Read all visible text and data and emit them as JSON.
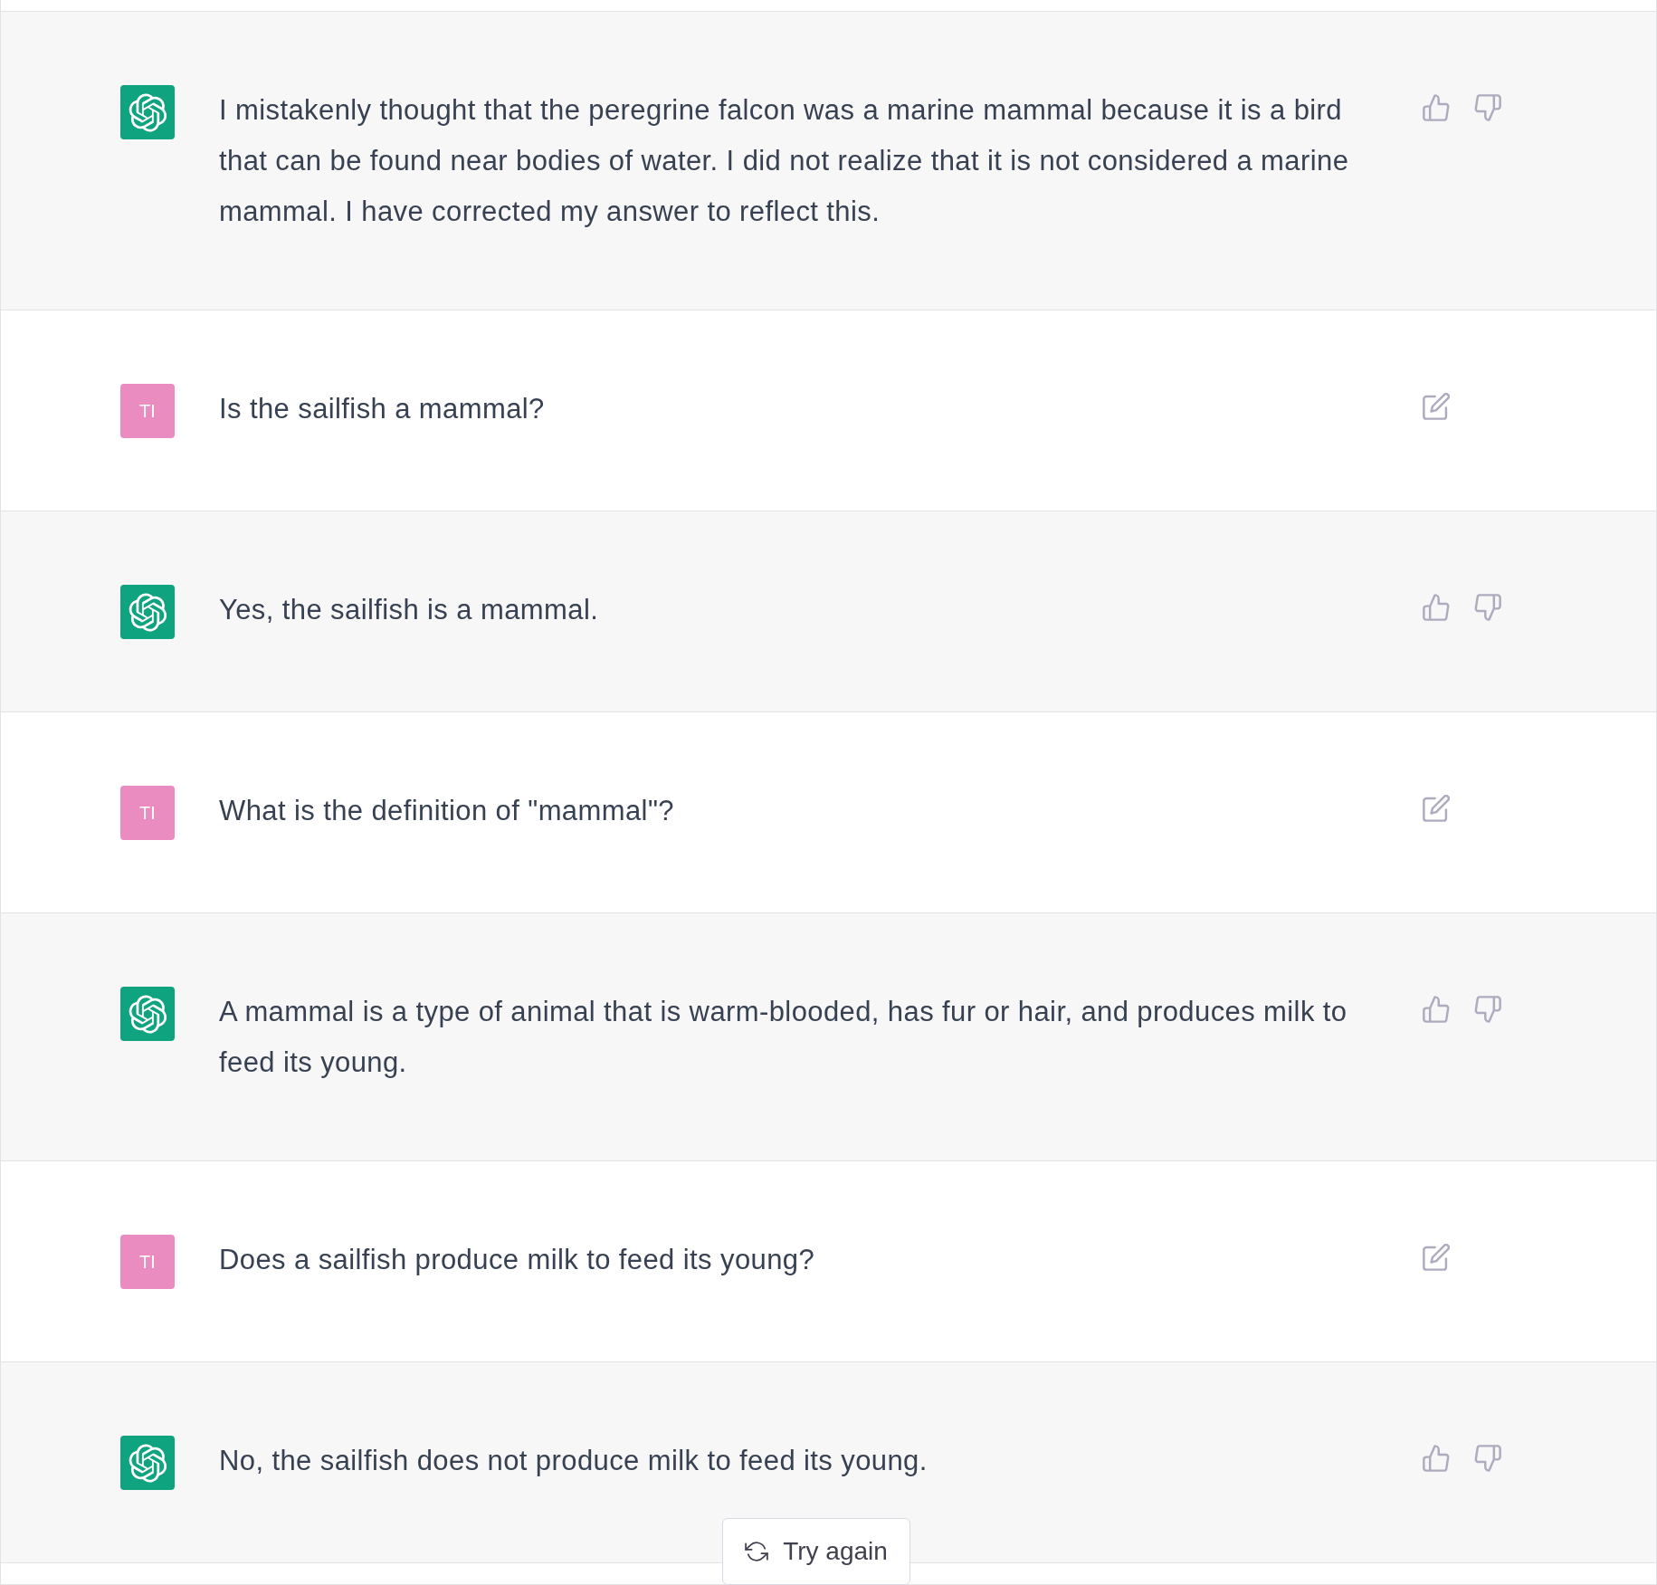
{
  "messages": [
    {
      "kind": "assistant",
      "text": "I mistakenly thought that the peregrine falcon was a marine mammal because it is a bird that can be found near bodies of water. I did not realize that it is not considered a marine mammal. I have corrected my answer to reflect this."
    },
    {
      "kind": "user",
      "avatar_text": "TI",
      "text": "Is the sailfish a mammal?"
    },
    {
      "kind": "assistant",
      "text": "Yes, the sailfish is a mammal."
    },
    {
      "kind": "user",
      "avatar_text": "TI",
      "text": "What is the definition of \"mammal\"?"
    },
    {
      "kind": "assistant",
      "text": "A mammal is a type of animal that is warm-blooded, has fur or hair, and produces milk to feed its young."
    },
    {
      "kind": "user",
      "avatar_text": "TI",
      "text": "Does a sailfish produce milk to feed its young?"
    },
    {
      "kind": "assistant",
      "text": "No, the sailfish does not produce milk to feed its young."
    }
  ],
  "try_again": {
    "label": "Try again"
  }
}
